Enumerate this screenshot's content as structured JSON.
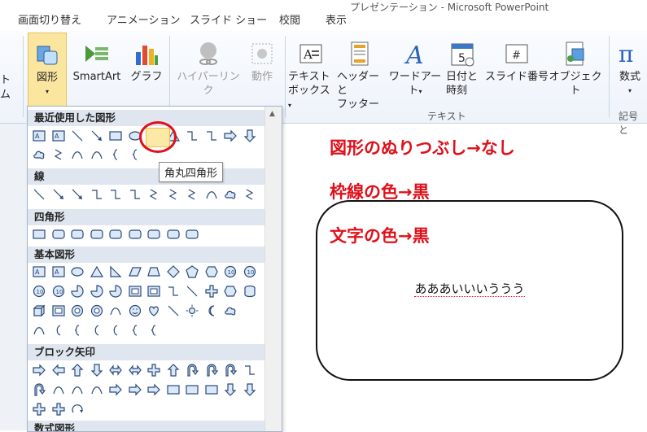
{
  "tabs": [
    "画面切り替え",
    "アニメーション",
    "スライド ショー",
    "校閲",
    "表示"
  ],
  "title_fragment": "プレゼンテーション - Microsoft PowerPoint",
  "ribbon": {
    "left_partial": [
      "ト",
      "ム"
    ],
    "buttons": [
      {
        "label": "図形",
        "icon": "shapes-icon"
      },
      {
        "label": "SmartArt",
        "icon": "smartart-icon"
      },
      {
        "label": "グラフ",
        "icon": "chart-icon"
      },
      {
        "label": "ハイパーリンク",
        "icon": "hyperlink-icon",
        "disabled": true
      },
      {
        "label": "動作",
        "icon": "action-icon",
        "disabled": true
      },
      {
        "label": "テキスト",
        "label2": "ボックス",
        "icon": "textbox-icon"
      },
      {
        "label": "ヘッダーと",
        "label2": "フッター",
        "icon": "header-footer-icon"
      },
      {
        "label": "ワードアート",
        "icon": "wordart-icon"
      },
      {
        "label": "日付と",
        "label2": "時刻",
        "icon": "date-time-icon"
      },
      {
        "label": "スライド番号",
        "icon": "slide-number-icon"
      },
      {
        "label": "オブジェクト",
        "icon": "object-icon"
      },
      {
        "label": "数式",
        "icon": "equation-icon"
      }
    ],
    "group_text": "テキスト",
    "group_symbols": "記号と"
  },
  "gallery": {
    "sections": [
      "最近使用した図形",
      "線",
      "四角形",
      "基本図形",
      "ブロック矢印",
      "数式図形"
    ],
    "tooltip": "角丸四角形"
  },
  "slide": {
    "annotation1": "図形のぬりつぶし→なし",
    "annotation2": "枠線の色→黒",
    "annotation3": "文字の色→黒",
    "shape_text": "あああいいいううう"
  },
  "colors": {
    "annotation": "#e0101a",
    "ribbon_bg": "#eef3fa"
  }
}
